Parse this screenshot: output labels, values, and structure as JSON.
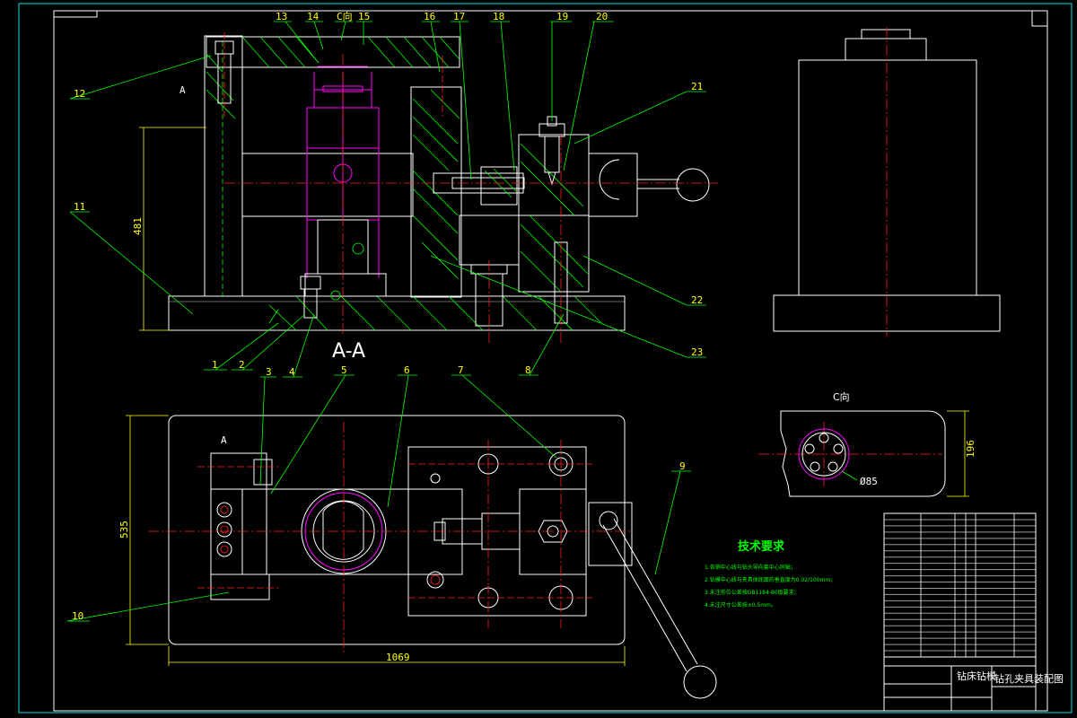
{
  "section_label": "A-A",
  "view_c_label": "C向",
  "view_c_top_label": "C向",
  "dims": {
    "height_481": "481",
    "height_535": "535",
    "width_1069": "1069",
    "view_c_dim": "196",
    "view_c_dia": "Ø85",
    "section_marker_a": "A",
    "section_marker_a2": "A"
  },
  "callouts": [
    "1",
    "2",
    "3",
    "4",
    "5",
    "6",
    "7",
    "8",
    "9",
    "10",
    "11",
    "12",
    "13",
    "14",
    "15",
    "16",
    "17",
    "18",
    "19",
    "20",
    "21",
    "22",
    "23"
  ],
  "tech_req": {
    "title": "技术要求",
    "lines": [
      "1.各销中心线与钻头导向套中心同轴；",
      "2.钻模中心线与夹具体底面的垂直度为0.02/100mm；",
      "3.未注形位公差按GB1184-80级要求；",
      "4.未注尺寸公差按±0.5mm。"
    ]
  },
  "title_block": {
    "name": "钻床钻模",
    "part": "钻孔夹具装配图"
  },
  "colors": {
    "background": "#000000",
    "outline": "#ffffff",
    "leader": "#00ff00",
    "centerline": "#ff2020",
    "dimension": "#ffff00",
    "part_highlight": "#ff00ff",
    "frame": "#00e0e0"
  }
}
